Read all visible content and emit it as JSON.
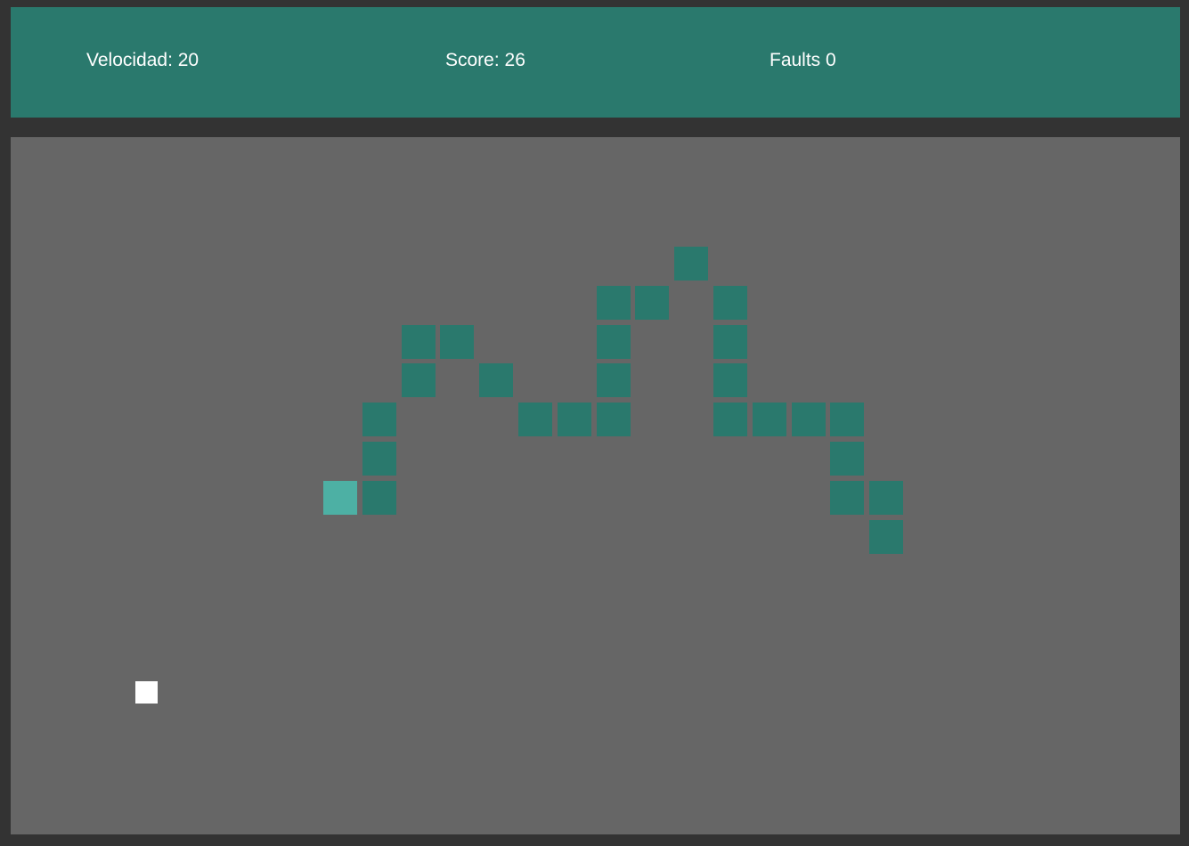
{
  "hud": {
    "speed_text": "Velocidad: 20",
    "score_text": "Score: 26",
    "faults_text": "Faults 0"
  },
  "colors": {
    "background": "#333333",
    "hud_background": "#2a796d",
    "board_background": "#666666",
    "snake_body": "#2a796d",
    "snake_head": "#4db0a4",
    "food": "#ffffff",
    "text": "#ffffff"
  },
  "game": {
    "grid_cols": 30,
    "grid_rows": 18,
    "head": [
      8,
      9
    ],
    "body": [
      [
        9,
        9
      ],
      [
        9,
        8
      ],
      [
        9,
        7
      ],
      [
        10,
        6
      ],
      [
        10,
        5
      ],
      [
        11,
        5
      ],
      [
        12,
        6
      ],
      [
        13,
        7
      ],
      [
        14,
        7
      ],
      [
        15,
        7
      ],
      [
        15,
        6
      ],
      [
        15,
        5
      ],
      [
        15,
        4
      ],
      [
        16,
        4
      ],
      [
        17,
        3
      ],
      [
        18,
        4
      ],
      [
        18,
        5
      ],
      [
        18,
        6
      ],
      [
        18,
        7
      ],
      [
        19,
        7
      ],
      [
        20,
        7
      ],
      [
        21,
        7
      ],
      [
        21,
        8
      ],
      [
        21,
        9
      ],
      [
        22,
        9
      ],
      [
        22,
        10
      ]
    ],
    "food": [
      3,
      14
    ]
  }
}
